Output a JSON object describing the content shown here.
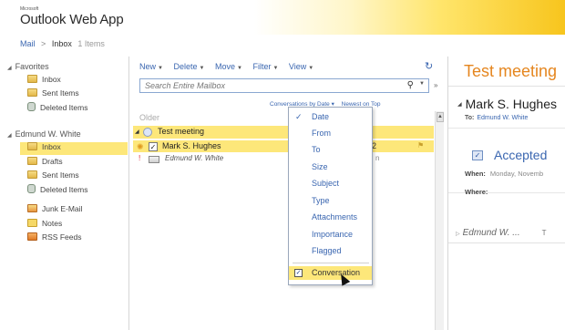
{
  "brand": {
    "company": "Microsoft",
    "app": "Outlook Web App"
  },
  "breadcrumb": {
    "mail": "Mail",
    "sep": ">",
    "folder": "Inbox",
    "count": "1 Items"
  },
  "sidebar": {
    "favorites": {
      "title": "Favorites",
      "items": [
        "Inbox",
        "Sent Items",
        "Deleted Items"
      ]
    },
    "account": {
      "title": "Edmund W. White",
      "items": [
        "Inbox",
        "Drafts",
        "Sent Items",
        "Deleted Items",
        "Junk E-Mail",
        "Notes",
        "RSS Feeds"
      ]
    }
  },
  "toolbar": {
    "new": "New",
    "delete": "Delete",
    "move": "Move",
    "filter": "Filter",
    "view": "View"
  },
  "search": {
    "placeholder": "Search Entire Mailbox"
  },
  "sortbar": {
    "by": "Conversations by Date",
    "order": "Newest on Top"
  },
  "list": {
    "group": "Older",
    "conversation": {
      "subject": "Test meeting"
    },
    "item": {
      "sender": "Mark S. Hughes",
      "date_fragment": "2"
    },
    "subitem": {
      "sender": "Edmund W. White",
      "trail": "n"
    }
  },
  "menu": {
    "items": [
      "Date",
      "From",
      "To",
      "Size",
      "Subject",
      "Type",
      "Attachments",
      "Importance",
      "Flagged"
    ],
    "checked_item": "Date",
    "toggle": "Conversation"
  },
  "reading": {
    "title": "Test meeting",
    "from": "Mark S. Hughes",
    "to_label": "To:",
    "to_value": "Edmund W. White",
    "status": "Accepted",
    "when_label": "When:",
    "when_value": "Monday, Novemb",
    "where_label": "Where:",
    "sender": "Edmund W. ...",
    "sender_trail": "T"
  },
  "colors": {
    "accent": "#e5861f",
    "highlight": "#fde77a",
    "link": "#3a66b0"
  }
}
